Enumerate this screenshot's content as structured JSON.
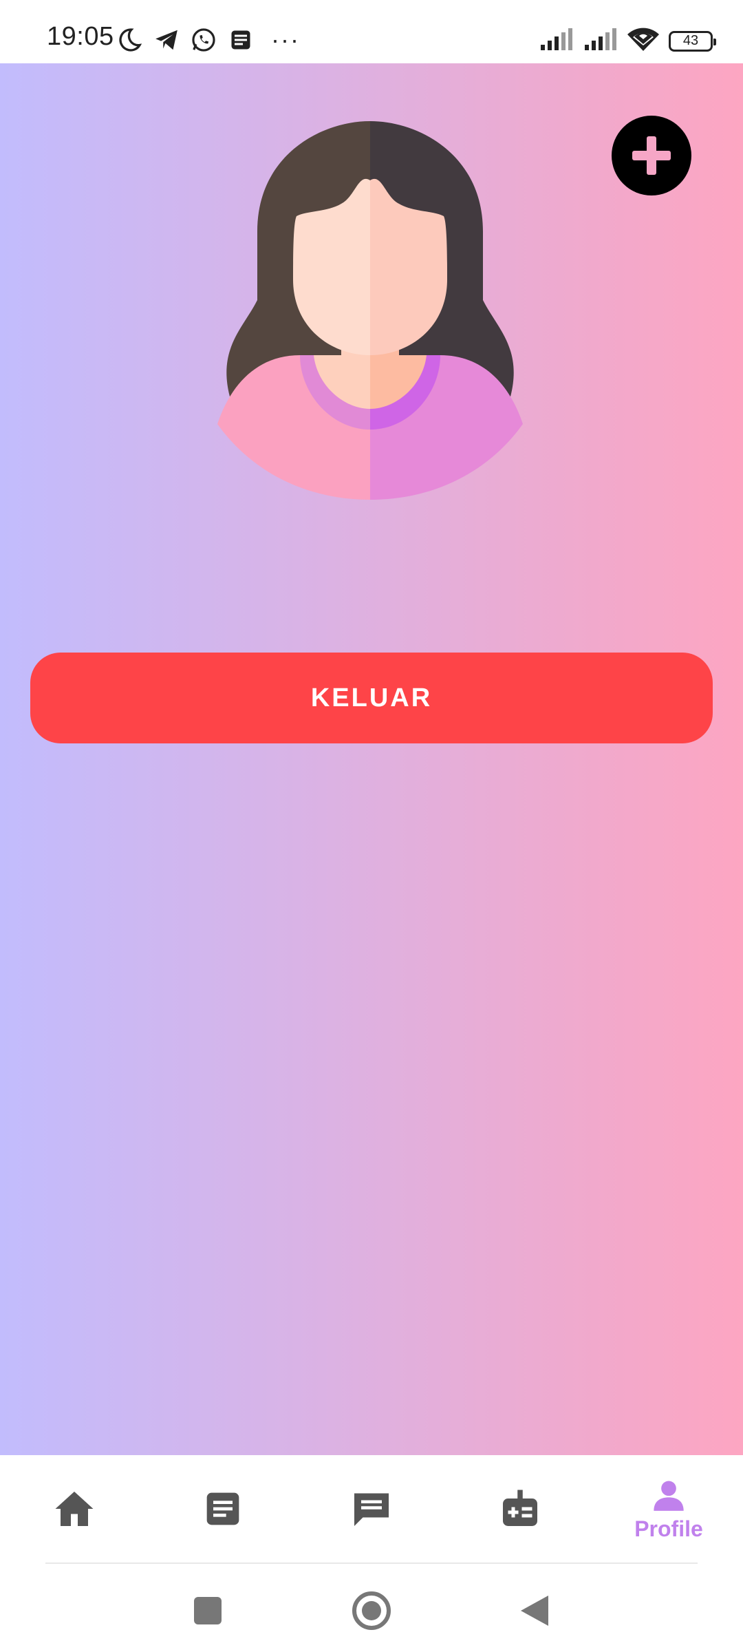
{
  "status_bar": {
    "time": "19:05",
    "more": "···",
    "battery": "43",
    "icons": [
      "moon-icon",
      "telegram-icon",
      "whatsapp-icon",
      "notes-icon",
      "signal-icon",
      "signal-icon",
      "wifi-icon",
      "battery-icon"
    ]
  },
  "main": {
    "background_colors": [
      "#c2bcfd",
      "#fda6c2"
    ],
    "avatar": "woman-avatar",
    "add_icon": "plus-icon",
    "logout_label": "KELUAR",
    "logout_color": "#fe4448"
  },
  "bottom_nav": {
    "items": [
      {
        "icon": "home-icon",
        "label": ""
      },
      {
        "icon": "document-icon",
        "label": ""
      },
      {
        "icon": "chat-icon",
        "label": ""
      },
      {
        "icon": "medical-kit-icon",
        "label": ""
      },
      {
        "icon": "person-icon",
        "label": "Profile",
        "active": true
      }
    ],
    "active_color": "#c081ec",
    "inactive_color": "#555555"
  },
  "system_nav": {
    "buttons": [
      "recents-icon",
      "home-circle-icon",
      "back-icon"
    ]
  }
}
